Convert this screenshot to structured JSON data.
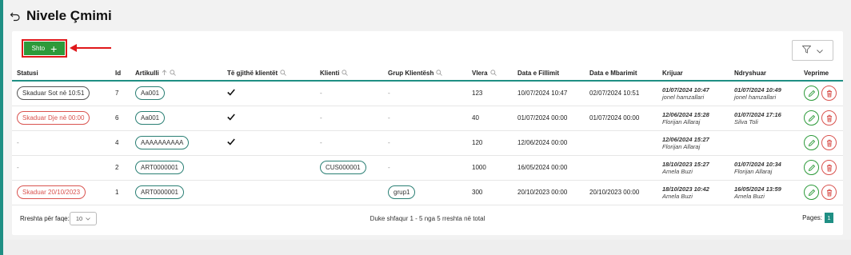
{
  "page": {
    "title": "Nivele Çmimi"
  },
  "toolbar": {
    "add_label": "Shto",
    "add_icon": "plus-icon",
    "filter_icon": "filter-icon"
  },
  "colors": {
    "accent": "#1f8f84",
    "add_button": "#2d9a3a",
    "highlight": "#e0181b",
    "danger": "#d9534f"
  },
  "table": {
    "columns": [
      "Statusi",
      "Id",
      "Artikulli",
      "Të gjithë klientët",
      "Klienti",
      "Grup Klientësh",
      "Vlera",
      "Data e Fillimit",
      "Data e Mbarimit",
      "Krijuar",
      "Ndryshuar",
      "Veprime"
    ],
    "rows": [
      {
        "status": "Skaduar Sot në 10:51",
        "status_color": "dark",
        "id": "7",
        "artikulli": "Aa001",
        "all_clients": true,
        "klienti": "-",
        "grup": "-",
        "vlera": "123",
        "start": "10/07/2024 10:47",
        "end": "02/07/2024 10:51",
        "created_at": "01/07/2024 10:47",
        "created_by": "jonel hamzallari",
        "modified_at": "01/07/2024 10:49",
        "modified_by": "jonel hamzallari"
      },
      {
        "status": "Skaduar Dje në 00:00",
        "status_color": "red",
        "id": "6",
        "artikulli": "Aa001",
        "all_clients": true,
        "klienti": "-",
        "grup": "-",
        "vlera": "40",
        "start": "01/07/2024 00:00",
        "end": "01/07/2024 00:00",
        "created_at": "12/06/2024 15:28",
        "created_by": "Florijan Allaraj",
        "modified_at": "01/07/2024 17:16",
        "modified_by": "Silva Toli"
      },
      {
        "status": "-",
        "status_color": "none",
        "id": "4",
        "artikulli": "AAAAAAAAAA",
        "all_clients": true,
        "klienti": "-",
        "grup": "-",
        "vlera": "120",
        "start": "12/06/2024 00:00",
        "end": "",
        "created_at": "12/06/2024 15:27",
        "created_by": "Florijan Allaraj",
        "modified_at": "",
        "modified_by": ""
      },
      {
        "status": "-",
        "status_color": "none",
        "id": "2",
        "artikulli": "ART0000001",
        "all_clients": false,
        "klienti": "CUS000001",
        "grup": "-",
        "vlera": "1000",
        "start": "16/05/2024 00:00",
        "end": "",
        "created_at": "18/10/2023 15:27",
        "created_by": "Amela Buzi",
        "modified_at": "01/07/2024 10:34",
        "modified_by": "Florijan Allaraj"
      },
      {
        "status": "Skaduar 20/10/2023",
        "status_color": "red",
        "id": "1",
        "artikulli": "ART0000001",
        "all_clients": false,
        "klienti": "",
        "grup": "grup1",
        "vlera": "300",
        "start": "20/10/2023 00:00",
        "end": "20/10/2023 00:00",
        "created_at": "18/10/2023 10:42",
        "created_by": "Amela Buzi",
        "modified_at": "16/05/2024 13:59",
        "modified_by": "Amela Buzi"
      }
    ]
  },
  "footer": {
    "rows_label": "Rreshta për faqe:",
    "rows_value": "10",
    "summary": "Duke shfaqur 1 - 5 nga 5 rreshta në total",
    "pages_label": "Pages:",
    "current_page": "1"
  }
}
